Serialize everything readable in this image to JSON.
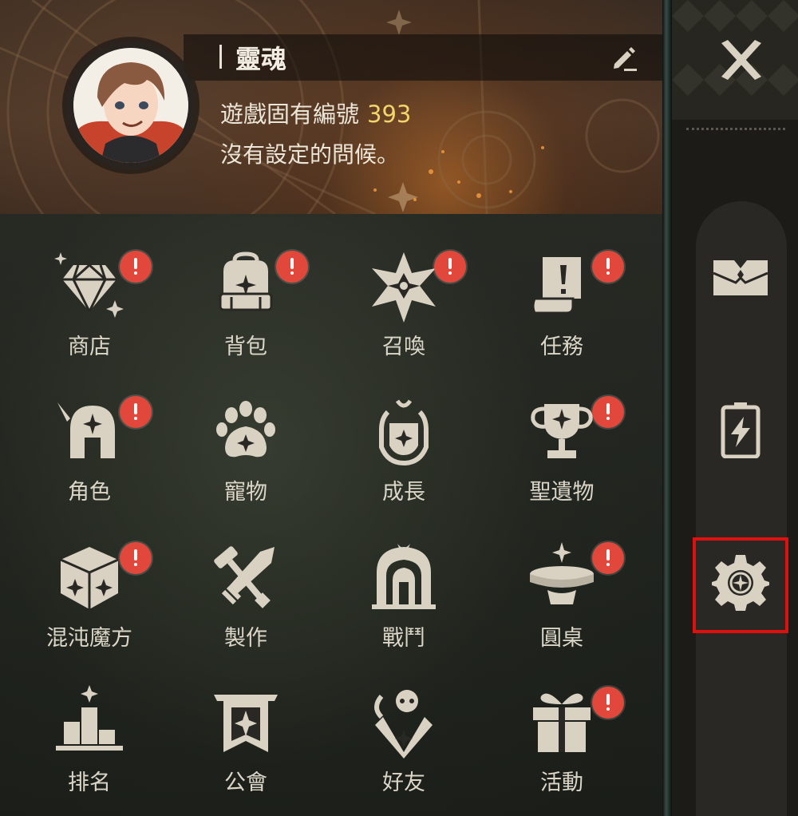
{
  "profile": {
    "name": "靈魂",
    "uid_label": "遊戲固有編號",
    "uid_value": "393",
    "greeting": "沒有設定的問候。"
  },
  "menu": [
    {
      "label": "商店",
      "icon": "diamond-icon",
      "badge": true
    },
    {
      "label": "背包",
      "icon": "backpack-icon",
      "badge": true
    },
    {
      "label": "召喚",
      "icon": "summon-star-icon",
      "badge": true
    },
    {
      "label": "任務",
      "icon": "quest-scroll-icon",
      "badge": true
    },
    {
      "label": "角色",
      "icon": "helmet-icon",
      "badge": true
    },
    {
      "label": "寵物",
      "icon": "paw-icon",
      "badge": false
    },
    {
      "label": "成長",
      "icon": "growth-emblem-icon",
      "badge": false
    },
    {
      "label": "聖遺物",
      "icon": "trophy-icon",
      "badge": true
    },
    {
      "label": "混沌魔方",
      "icon": "cube-icon",
      "badge": true
    },
    {
      "label": "製作",
      "icon": "hammer-sword-icon",
      "badge": false
    },
    {
      "label": "戰鬥",
      "icon": "gate-icon",
      "badge": false
    },
    {
      "label": "圓桌",
      "icon": "round-table-icon",
      "badge": true
    },
    {
      "label": "排名",
      "icon": "ranking-icon",
      "badge": false
    },
    {
      "label": "公會",
      "icon": "guild-banner-icon",
      "badge": false
    },
    {
      "label": "好友",
      "icon": "friends-icon",
      "badge": false
    },
    {
      "label": "活動",
      "icon": "gift-icon",
      "badge": true
    }
  ],
  "sidebar": {
    "items": [
      {
        "icon": "close-icon"
      },
      {
        "icon": "mailbox-icon"
      },
      {
        "icon": "battery-icon"
      },
      {
        "icon": "settings-gear-icon",
        "highlighted": true
      }
    ]
  },
  "colors": {
    "badge": "#e1473a",
    "uid_value": "#f2d56b",
    "highlight": "#e0100f",
    "icon": "#d9d2c3"
  }
}
